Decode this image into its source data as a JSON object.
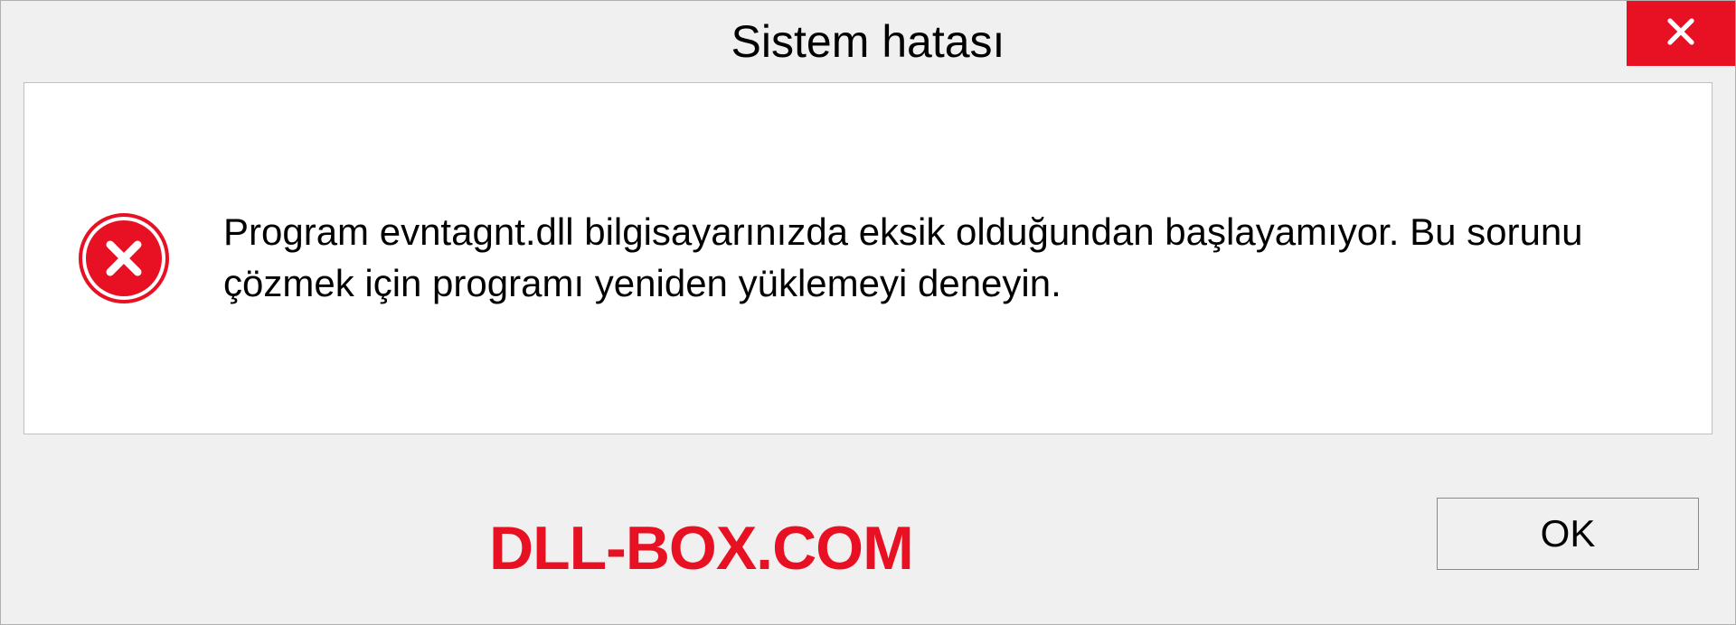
{
  "dialog": {
    "title": "Sistem hatası",
    "message": "Program evntagnt.dll bilgisayarınızda eksik olduğundan başlayamıyor. Bu sorunu çözmek için programı yeniden yüklemeyi deneyin.",
    "ok_label": "OK"
  },
  "watermark": "DLL-BOX.COM",
  "colors": {
    "close_red": "#e81123",
    "error_red": "#e81123"
  }
}
